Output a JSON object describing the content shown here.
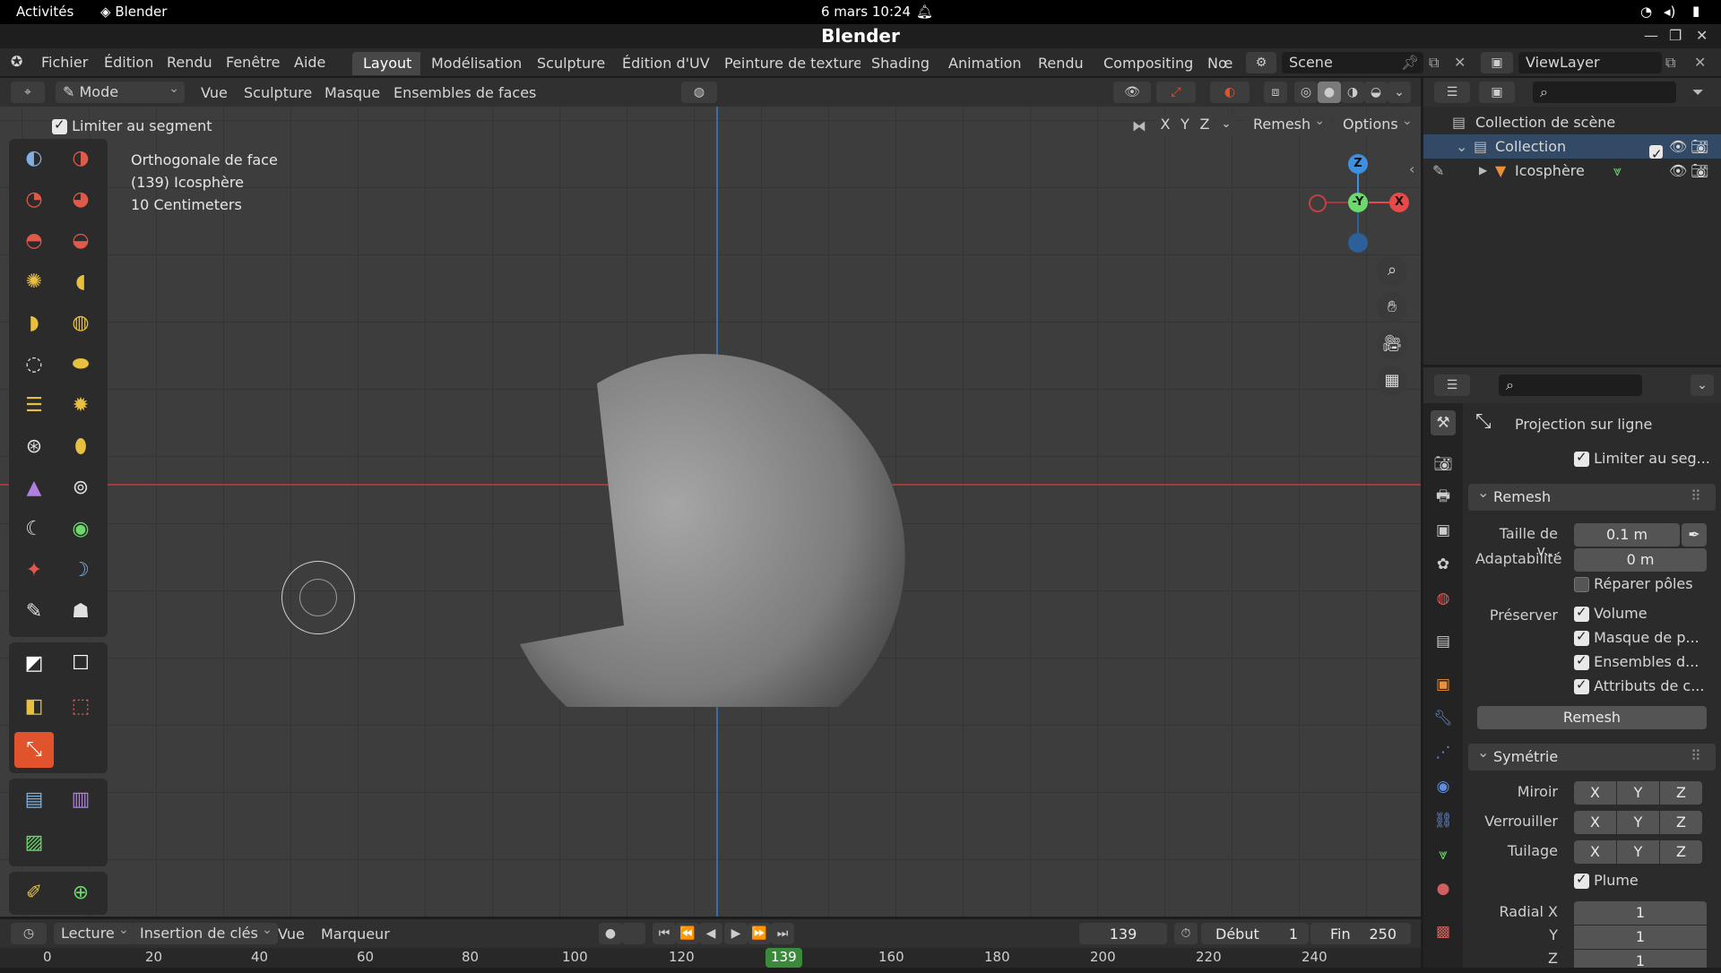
{
  "system": {
    "activities": "Activités",
    "app_name": "Blender",
    "datetime": "6 mars  10:24"
  },
  "window": {
    "title": "Blender"
  },
  "menu": {
    "items": [
      "Fichier",
      "Édition",
      "Rendu",
      "Fenêtre",
      "Aide"
    ]
  },
  "workspaces": [
    "Layout",
    "Modélisation",
    "Sculpture",
    "Édition d'UV",
    "Peinture de texture",
    "Shading",
    "Animation",
    "Rendu",
    "Compositing",
    "Nœ"
  ],
  "scene": {
    "name": "Scene"
  },
  "viewlayer": {
    "name": "ViewLayer"
  },
  "viewport_header": {
    "mode": "Mode scul...",
    "menus": [
      "Vue",
      "Sculpture",
      "Masque",
      "Ensembles de faces"
    ],
    "remesh": "Remesh",
    "options": "Options",
    "axes": [
      "X",
      "Y",
      "Z"
    ]
  },
  "tool_settings": {
    "limit_segment": "Limiter au segment"
  },
  "overlay": {
    "view": "Orthogonale de face",
    "object": "(139) Icosphère",
    "scale": "10 Centimeters"
  },
  "gizmo": {
    "z": "Z",
    "y": "-Y",
    "x": "X"
  },
  "outliner": {
    "scene_collection": "Collection de scène",
    "collection": "Collection",
    "object": "Icosphère"
  },
  "properties": {
    "tool_name": "Projection sur ligne",
    "limit_segment": "Limiter au seg...",
    "remesh_panel": "Remesh",
    "voxel_size_label": "Taille de v...",
    "voxel_size_value": "0.1 m",
    "adaptivity_label": "Adaptabilité",
    "adaptivity_value": "0 m",
    "fix_poles": "Réparer pôles",
    "preserve_label": "Préserver",
    "preserve_volume": "Volume",
    "preserve_mask": "Masque de p...",
    "preserve_facesets": "Ensembles d...",
    "preserve_attributes": "Attributs de c...",
    "remesh_button": "Remesh",
    "symmetry_panel": "Symétrie",
    "mirror_label": "Miroir",
    "lock_label": "Verrouiller",
    "tiling_label": "Tuilage",
    "axis_x": "X",
    "axis_y": "Y",
    "axis_z": "Z",
    "feather": "Plume",
    "radial_x_label": "Radial X",
    "radial_x": "1",
    "radial_y_label": "Y",
    "radial_y": "1",
    "radial_z_label": "Z",
    "radial_z": "1"
  },
  "timeline": {
    "playback": "Lecture",
    "keying": "Insertion de clés",
    "view": "Vue",
    "marker": "Marqueur",
    "current_frame": "139",
    "start_label": "Début",
    "start": "1",
    "end_label": "Fin",
    "end": "250",
    "ticks": [
      "0",
      "20",
      "40",
      "60",
      "80",
      "100",
      "120",
      "139",
      "160",
      "180",
      "200",
      "220",
      "240"
    ]
  },
  "colors": {
    "accent": "#e0532c",
    "active_frame": "#3b8a3b",
    "axis_x": "#e84a4a",
    "axis_y": "#6dd96d",
    "axis_z": "#3f8fe0"
  }
}
